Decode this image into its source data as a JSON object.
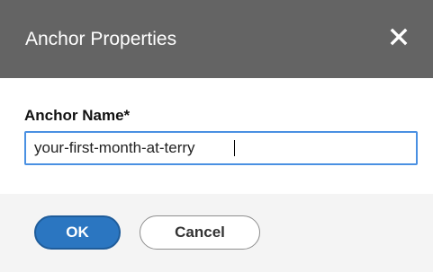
{
  "dialog": {
    "title": "Anchor Properties",
    "close_icon": "close-icon"
  },
  "form": {
    "anchor_name_label": "Anchor Name*",
    "anchor_name_value": "your-first-month-at-terry"
  },
  "footer": {
    "ok_label": "OK",
    "cancel_label": "Cancel"
  },
  "colors": {
    "title_bar": "#646464",
    "primary_button": "#2b76c1",
    "input_focus_border": "#4a90e2",
    "footer_background": "#f4f4f4"
  }
}
